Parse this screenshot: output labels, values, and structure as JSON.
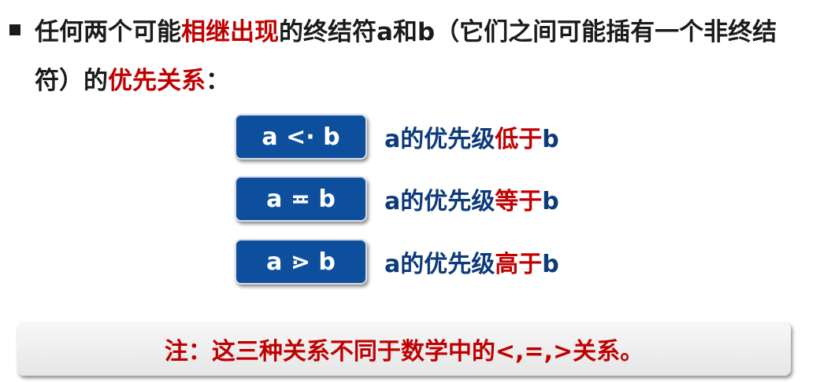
{
  "intro": {
    "line1_part1": "任何两个可能",
    "line1_highlight": "相继出现",
    "line1_part2": "的终结符a和b（它们之间可能插有一个非终结",
    "line2_part1": "符）的",
    "line2_highlight": "优先关系",
    "line2_part2": "："
  },
  "relations": [
    {
      "symbol": "a <· b",
      "desc_prefix": "a的优先级",
      "desc_highlight": "低于",
      "desc_suffix": "b"
    },
    {
      "symbol": "a ≖ b",
      "desc_prefix": "a的优先级",
      "desc_highlight": "等于",
      "desc_suffix": "b"
    },
    {
      "symbol": "a ⋗ b",
      "desc_prefix": "a的优先级",
      "desc_highlight": "高于",
      "desc_suffix": "b"
    }
  ],
  "note": {
    "text": "注：这三种关系不同于数学中的<,=,>关系。"
  },
  "colors": {
    "highlight": "#c00000",
    "box_blue": "#0d4f9c",
    "desc_blue": "#0d3a7a"
  }
}
